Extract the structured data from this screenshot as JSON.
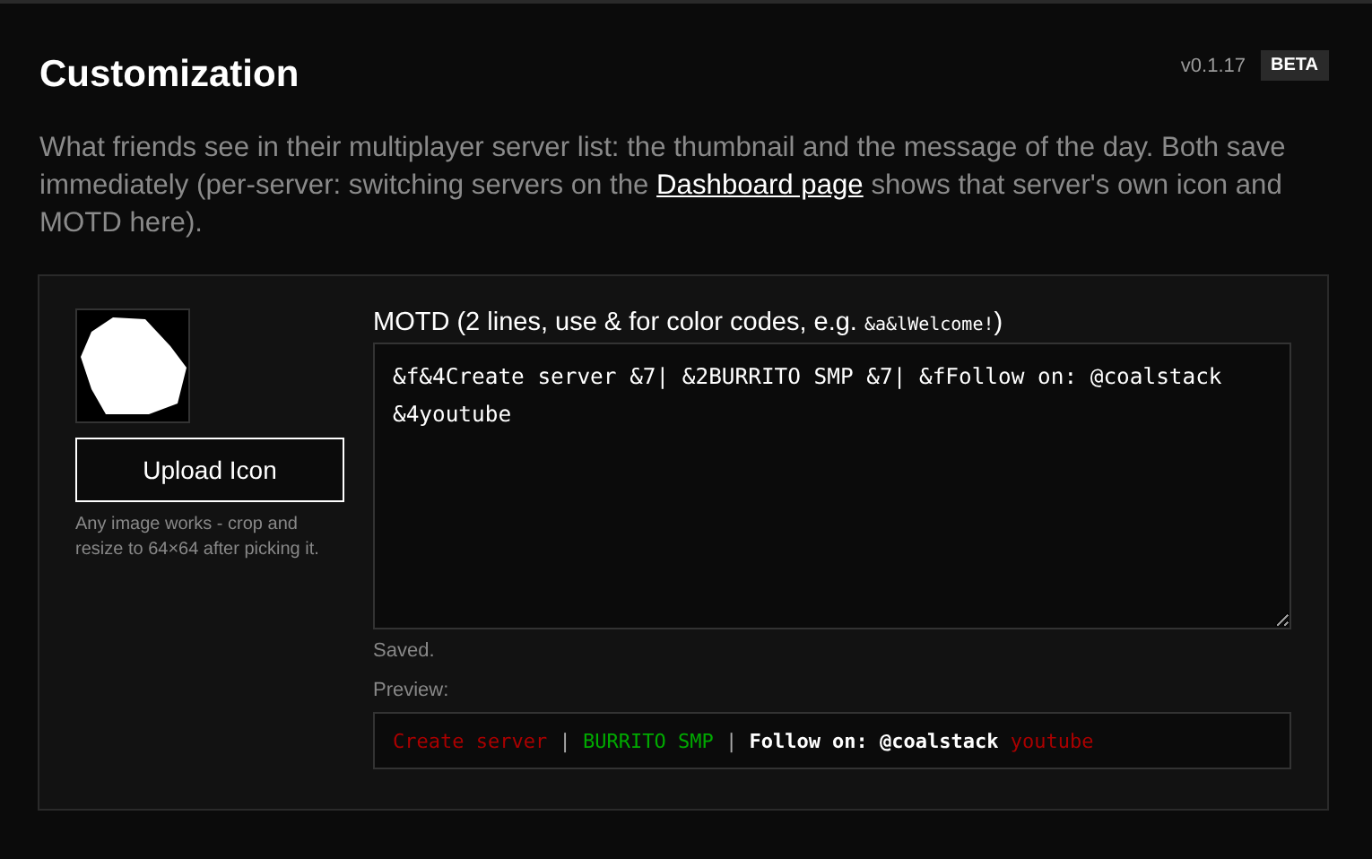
{
  "header": {
    "title": "Customization",
    "version": "v0.1.17",
    "badge": "BETA"
  },
  "description": {
    "before": "What friends see in their multiplayer server list: the thumbnail and the message of the day. Both save immediately (per-server: switching servers on the ",
    "link": "Dashboard page",
    "after": " shows that server's own icon and MOTD here)."
  },
  "icon_panel": {
    "button": "Upload Icon",
    "hint": "Any image works - crop and resize to 64×64 after picking it."
  },
  "motd": {
    "label_before": "MOTD (2 lines, use & for color codes, e.g. ",
    "example": "&a&lWelcome!",
    "label_after": ")",
    "value": "&f&4Create server &7| &2BURRITO SMP &7| &fFollow on: @coalstack\n&4youtube",
    "status": "Saved.",
    "preview_label": "Preview:",
    "preview": [
      {
        "text": "Create server ",
        "color": "#aa0000",
        "bold": false
      },
      {
        "text": "| ",
        "color": "#aaaaaa",
        "bold": false
      },
      {
        "text": "BURRITO SMP ",
        "color": "#00aa00",
        "bold": false
      },
      {
        "text": "| ",
        "color": "#aaaaaa",
        "bold": false
      },
      {
        "text": "Follow on: @coalstack ",
        "color": "#ffffff",
        "bold": true
      },
      {
        "text": "youtube",
        "color": "#aa0000",
        "bold": false
      }
    ]
  }
}
